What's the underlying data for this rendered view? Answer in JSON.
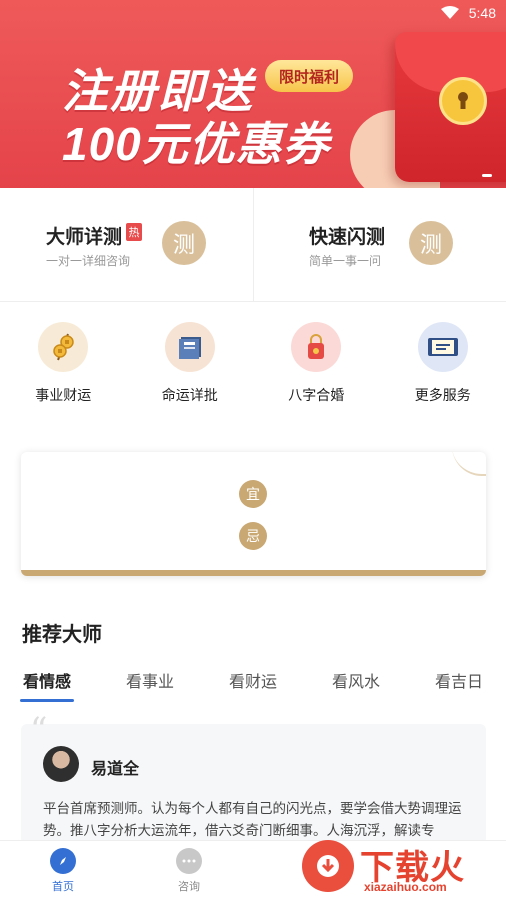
{
  "status_bar": {
    "time": "5:48"
  },
  "banner": {
    "line1": "注册即送",
    "line2": "100元优惠券",
    "tag": "限时福利"
  },
  "consult": [
    {
      "title": "大师详测",
      "badge": "热",
      "subtitle": "一对一详细咨询",
      "icon_char": "测"
    },
    {
      "title": "快速闪测",
      "subtitle": "简单一事一问",
      "icon_char": "测"
    }
  ],
  "services": [
    {
      "label": "事业财运",
      "icon": "coins-icon"
    },
    {
      "label": "命运详批",
      "icon": "book-icon"
    },
    {
      "label": "八字合婚",
      "icon": "lock-icon"
    },
    {
      "label": "更多服务",
      "icon": "scroll-icon"
    }
  ],
  "almanac": {
    "yi": "宜",
    "ji": "忌"
  },
  "recommend": {
    "title": "推荐大师",
    "tabs": [
      "看情感",
      "看事业",
      "看财运",
      "看风水",
      "看吉日"
    ],
    "active_tab": 0,
    "master": {
      "name": "易道全",
      "description": "平台首席预测师。认为每个人都有自己的闪光点，要学会借大势调理运势。推八字分析大运流年，借六爻奇门断细事。人海沉浮，解读专"
    }
  },
  "bottom_nav": [
    {
      "label": "首页",
      "active": true
    },
    {
      "label": "咨询",
      "active": false
    }
  ],
  "watermark": {
    "text": "下载火",
    "url": "xiazaihuo.com"
  },
  "colors": {
    "accent": "#3470d4",
    "banner": "#e8474c",
    "gold": "#c9a874"
  }
}
